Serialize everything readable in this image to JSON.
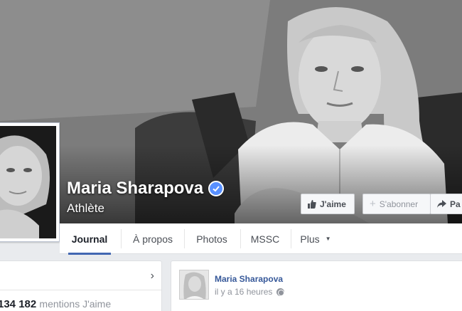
{
  "profile": {
    "name": "Maria Sharapova",
    "category": "Athlète",
    "verified_icon": "verified-badge-icon"
  },
  "actions": {
    "like_label": "J'aime",
    "follow_label": "S'abonner",
    "share_label": "Pa"
  },
  "tabs": [
    {
      "label": "Journal",
      "active": true
    },
    {
      "label": "À propos",
      "active": false
    },
    {
      "label": "Photos",
      "active": false
    },
    {
      "label": "MSSC",
      "active": false
    },
    {
      "label": "Plus",
      "active": false
    }
  ],
  "left_card": {
    "likes_count": "134 182",
    "likes_label": "mentions J'aime"
  },
  "post": {
    "author": "Maria Sharapova",
    "time": "il y a 16 heures",
    "privacy_icon": "globe-icon"
  },
  "colors": {
    "accent": "#4267b2",
    "link": "#365899",
    "verified": "#5890ff"
  }
}
